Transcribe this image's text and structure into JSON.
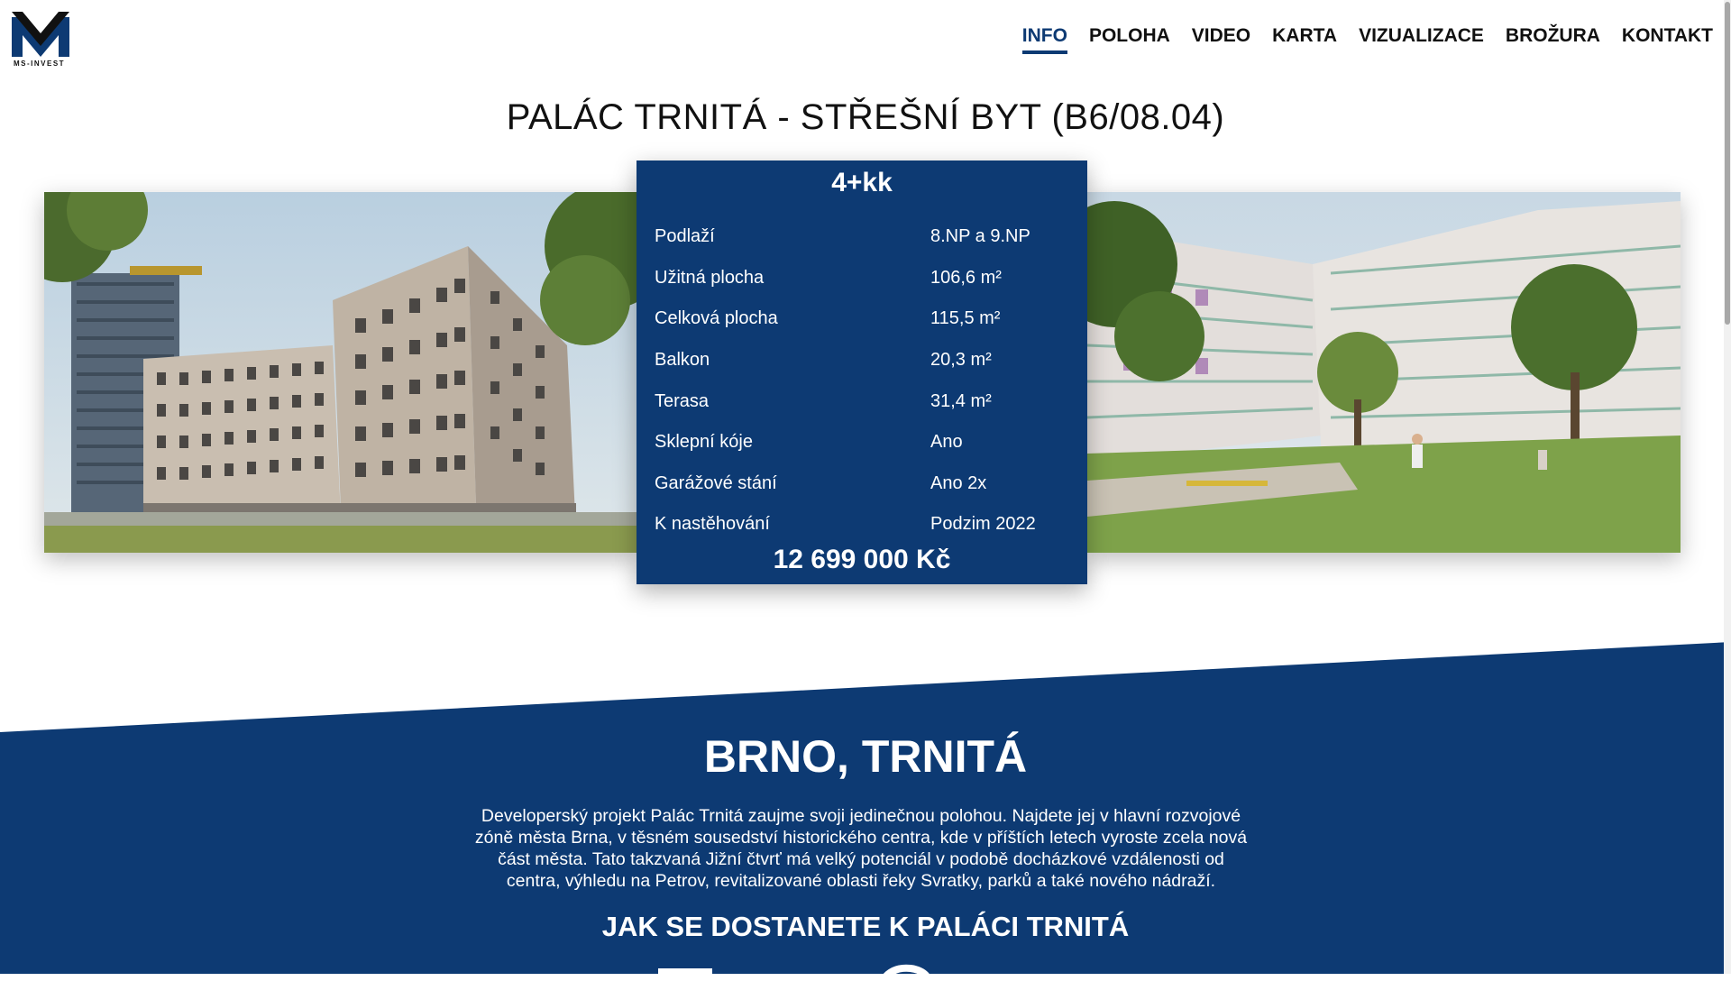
{
  "brand": {
    "logo_text": "MS-INVEST",
    "color_primary": "#0d3a73"
  },
  "nav": {
    "items": [
      {
        "label": "INFO",
        "active": true
      },
      {
        "label": "POLOHA"
      },
      {
        "label": "VIDEO"
      },
      {
        "label": "KARTA"
      },
      {
        "label": "VIZUALIZACE"
      },
      {
        "label": "BROŽURA"
      },
      {
        "label": "KONTAKT"
      }
    ]
  },
  "page_title": "PALÁC TRNITÁ - STŘEŠNÍ BYT (B6/08.04)",
  "unit": {
    "type": "4+kk",
    "rows": [
      {
        "label": "Podlaží",
        "value": "8.NP a 9.NP"
      },
      {
        "label": "Užitná plocha",
        "value": "106,6 m²"
      },
      {
        "label": "Celková plocha",
        "value": "115,5 m²"
      },
      {
        "label": "Balkon",
        "value": "20,3 m²"
      },
      {
        "label": "Terasa",
        "value": "31,4 m²"
      },
      {
        "label": "Sklepní kóje",
        "value": "Ano"
      },
      {
        "label": "Garážové stání",
        "value": "Ano 2x"
      },
      {
        "label": "K nastěhování",
        "value": "Podzim 2022"
      }
    ],
    "price": "12 699 000 Kč"
  },
  "location": {
    "title": "BRNO, TRNITÁ",
    "description": "Developerský projekt Palác Trnitá zaujme svoji jedinečnou polohou. Najdete jej v hlavní rozvojové zóně města Brna, v těsném sousedství historického centra, kde v příštích letech vyroste zcela nová část města. Tato takzvaná Jižní čtvrť má velký potenciál v podobě docházkové vzdálenosti od centra, výhledu na Petrov, revitalizované oblasti řeky Svratky, parků a také nového nádraží.",
    "subtitle": "JAK SE DOSTANETE K PALÁCI TRNITÁ"
  },
  "images": {
    "left": "building-exterior-render",
    "right": "courtyard-garden-render"
  }
}
